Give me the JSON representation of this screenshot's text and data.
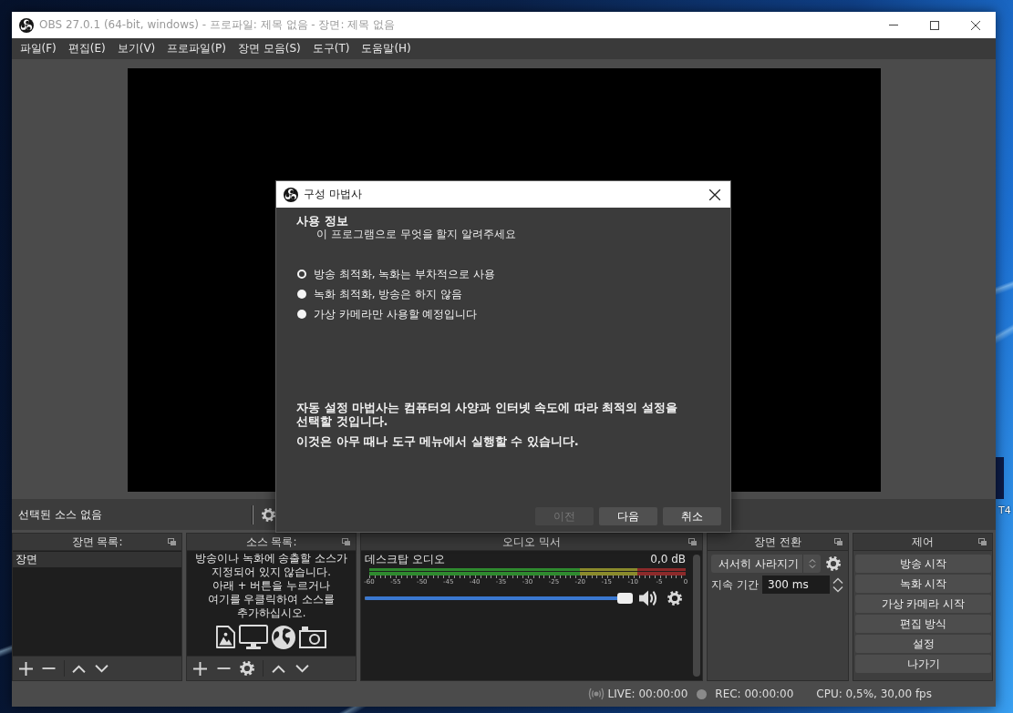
{
  "window": {
    "title": "OBS 27.0.1 (64-bit, windows) - 프로파일: 제목 없음 - 장면: 제목 없음"
  },
  "menu": [
    "파일(F)",
    "편집(E)",
    "보기(V)",
    "프로파일(P)",
    "장면 모음(S)",
    "도구(T)",
    "도움말(H)"
  ],
  "source_bar": {
    "label": "선택된 소스 없음"
  },
  "scenes": {
    "title": "장면 목록:",
    "items": [
      {
        "label": "장면",
        "selected": true
      }
    ]
  },
  "sources": {
    "title": "소스 목록:",
    "empty_hint": "방송이나 녹화에 송출할 소스가\n지정되어 있지 않습니다.\n아래 + 버튼을 누르거나\n여기를 우클릭하여 소스를\n추가하십시오."
  },
  "mixer": {
    "title": "오디오 믹서",
    "scale": [
      "-60",
      "-55",
      "-50",
      "-45",
      "-40",
      "-35",
      "-30",
      "-25",
      "-20",
      "-15",
      "-10",
      "-5",
      "0"
    ],
    "channels": [
      {
        "name": "데스크탑 오디오",
        "reading": "0,0 dB",
        "level": 1,
        "muted": false
      }
    ]
  },
  "transitions": {
    "title": "장면 전환",
    "transition": "서서히 사라지기",
    "duration_label": "지속 기간",
    "duration": "300 ms"
  },
  "controls": {
    "title": "제어",
    "buttons": [
      "방송 시작",
      "녹화 시작",
      "가상 카메라 시작",
      "편집 방식",
      "설정",
      "나가기"
    ]
  },
  "status_bar": {
    "live": "LIVE: 00:00:00",
    "rec": "REC: 00:00:00",
    "cpu": "CPU: 0,5%, 30,00 fps"
  },
  "dialog": {
    "title": "구성 마법사",
    "heading": "사용 정보",
    "subheading": "이 프로그램으로 무엇을 할지 알려주세요",
    "options": [
      {
        "label": "방송 최적화, 녹화는 부차적으로 사용",
        "selected": true
      },
      {
        "label": "녹화 최적화, 방송은 하지 않음",
        "selected": false
      },
      {
        "label": "가상 카메라만 사용할 예정입니다",
        "selected": false
      }
    ],
    "info": [
      "자동 설정 마법사는 컴퓨터의 사양과 인터넷 속도에 따라 최적의 설정을 선택할 것입니다.",
      "이것은 아무 때나 도구 메뉴에서 실행할 수 있습니다."
    ],
    "buttons": [
      {
        "label": "이전",
        "disabled": true
      },
      {
        "label": "다음",
        "disabled": false
      },
      {
        "label": "취소",
        "disabled": false
      }
    ]
  },
  "desktop": {
    "icons": [
      {
        "label": "T4"
      }
    ]
  }
}
